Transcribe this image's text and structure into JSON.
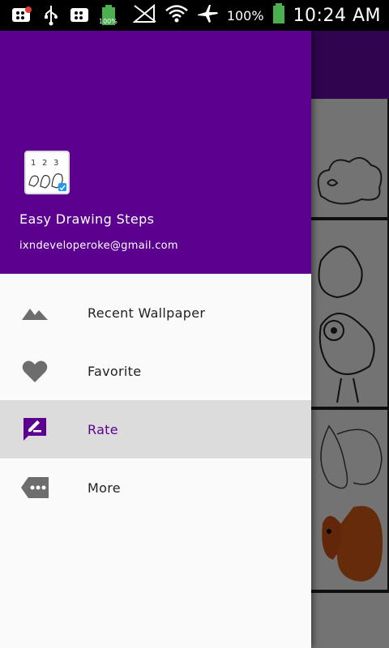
{
  "status_bar": {
    "battery_small_label": "100%",
    "battery_percent": "100%",
    "time": "10:24 AM"
  },
  "drawer": {
    "header": {
      "app_name": "Easy Drawing Steps",
      "email": "ixndeveloperoke@gmail.com"
    },
    "items": [
      {
        "label": "Recent Wallpaper",
        "icon": "landscape-icon"
      },
      {
        "label": "Favorite",
        "icon": "heart-icon"
      },
      {
        "label": "Rate",
        "icon": "rate-review-icon"
      },
      {
        "label": "More",
        "icon": "more-tag-icon"
      }
    ],
    "active_item": "Rate"
  },
  "colors": {
    "primary": "#5b008f",
    "icon_gray": "#6d6d6d",
    "active_bg": "#dcdcdc"
  }
}
